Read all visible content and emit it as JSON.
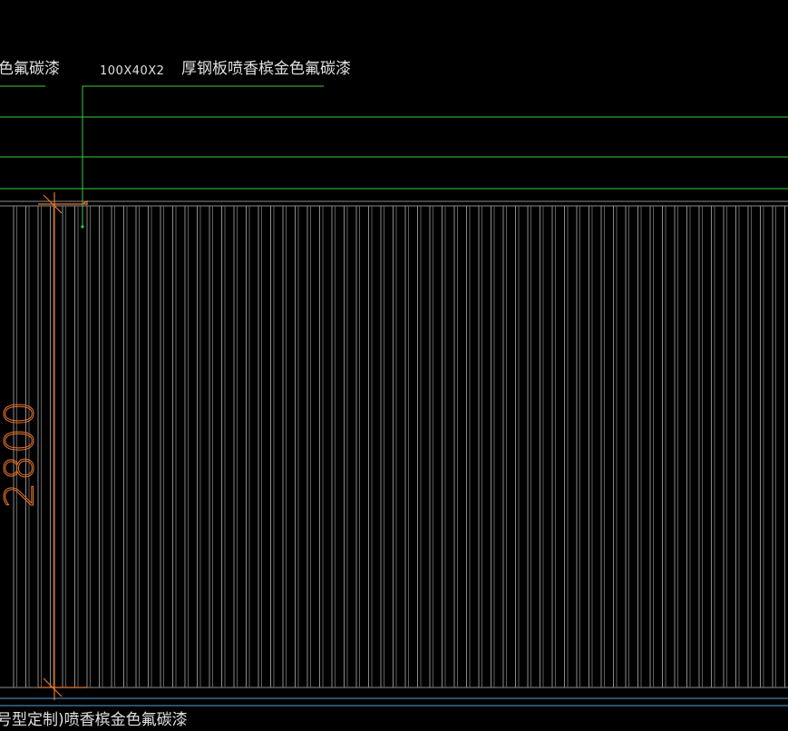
{
  "drawing": {
    "top_left_label": "色氟碳漆",
    "spec_label": "100X40X2",
    "material_label": "厚钢板喷香槟金色氟碳漆",
    "bottom_label": "号型定制)喷香槟金色氟碳漆",
    "dimension_value": "2800"
  },
  "colors": {
    "background": "#000000",
    "leader_line": "#3dcc3d",
    "panel_line": "#8c8c8c",
    "dimension": "#e8762c",
    "text": "#e0e0e0",
    "base_line": "#5aa0d8"
  }
}
